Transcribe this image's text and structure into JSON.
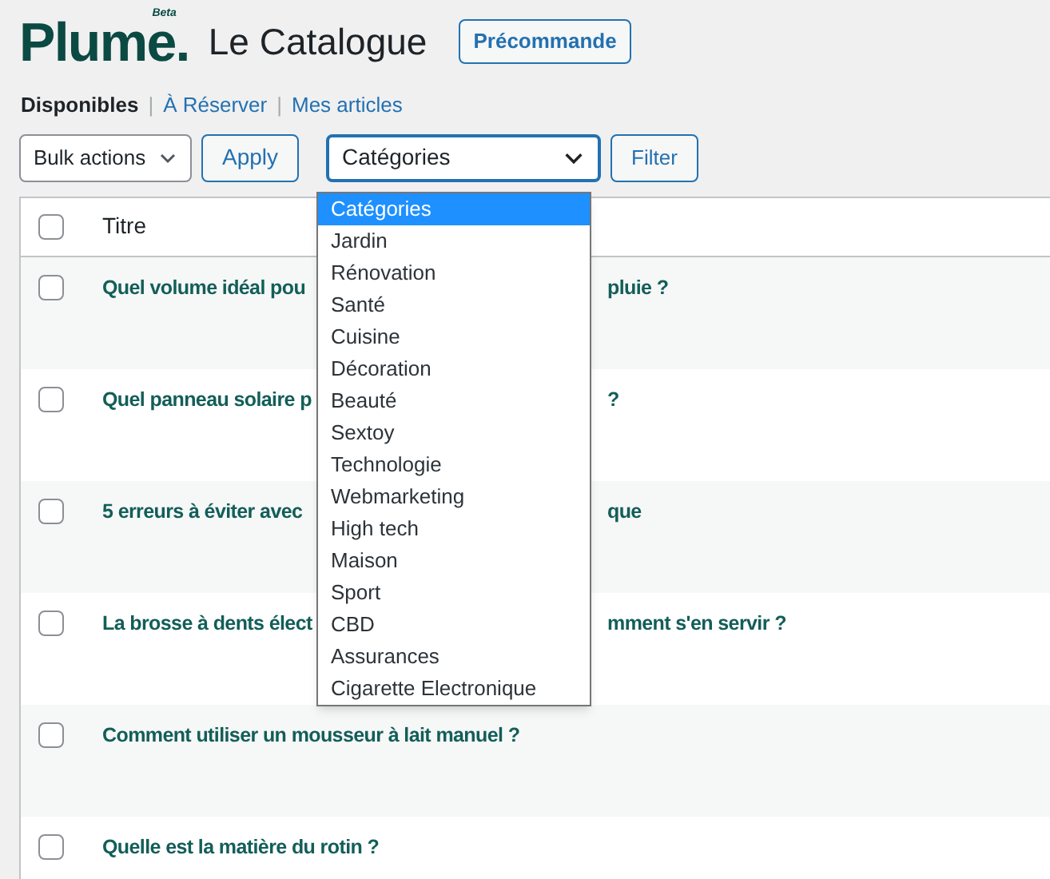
{
  "header": {
    "logo": "Plume.",
    "logo_badge": "Beta",
    "title": "Le Catalogue",
    "button": "Précommande"
  },
  "views": [
    {
      "label": "Disponibles",
      "selected": true
    },
    {
      "label": "À Réserver",
      "selected": false
    },
    {
      "label": "Mes articles",
      "selected": false
    }
  ],
  "separator": "|",
  "toolbar": {
    "bulk_actions": "Bulk actions",
    "apply": "Apply",
    "category_select": "Catégories",
    "filter": "Filter"
  },
  "dropdown": {
    "options": [
      {
        "label": "Catégories",
        "selected": true
      },
      {
        "label": "Jardin",
        "selected": false
      },
      {
        "label": "Rénovation",
        "selected": false
      },
      {
        "label": "Santé",
        "selected": false
      },
      {
        "label": "Cuisine",
        "selected": false
      },
      {
        "label": "Décoration",
        "selected": false
      },
      {
        "label": "Beauté",
        "selected": false
      },
      {
        "label": "Sextoy",
        "selected": false
      },
      {
        "label": "Technologie",
        "selected": false
      },
      {
        "label": "Webmarketing",
        "selected": false
      },
      {
        "label": "High tech",
        "selected": false
      },
      {
        "label": "Maison",
        "selected": false
      },
      {
        "label": "Sport",
        "selected": false
      },
      {
        "label": "CBD",
        "selected": false
      },
      {
        "label": "Assurances",
        "selected": false
      },
      {
        "label": "Cigarette Electronique",
        "selected": false
      }
    ]
  },
  "table": {
    "columns": [
      "Titre"
    ],
    "header_checked": false,
    "rows": [
      {
        "title_start": "Quel volume idéal pou",
        "title_end": "pluie ?",
        "checked": false
      },
      {
        "title_start": "Quel panneau solaire p",
        "title_end": "?",
        "checked": false
      },
      {
        "title_start": "5 erreurs à éviter avec",
        "title_end": "que",
        "checked": false
      },
      {
        "title_start": "La brosse à dents élect",
        "title_end": "mment s'en servir ?",
        "checked": false
      },
      {
        "title_start": "Comment utiliser un mousseur à lait manuel ?",
        "checked": false
      },
      {
        "title_start": "Quelle est la matière du rotin ?",
        "checked": false
      }
    ]
  }
}
